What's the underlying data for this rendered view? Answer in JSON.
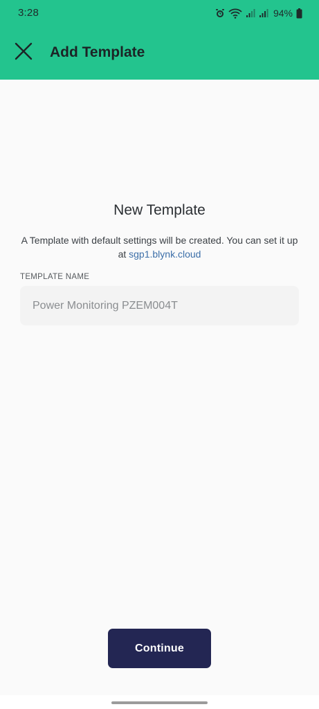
{
  "status_bar": {
    "time": "3:28",
    "battery_percent": "94%",
    "icons": [
      "alarm-icon",
      "wifi-icon",
      "signal-icon",
      "signal-icon",
      "battery-icon"
    ]
  },
  "app_bar": {
    "title": "Add Template",
    "close_icon": "close-icon",
    "background_color": "#23c48e"
  },
  "main": {
    "heading": "New Template",
    "description_prefix": "A Template with default settings will be created. You can set it up at ",
    "description_link": "sgp1.blynk.cloud",
    "field_label": "TEMPLATE NAME",
    "field_value": "Power Monitoring PZEM004T",
    "link_color": "#3b6ea8"
  },
  "actions": {
    "continue_label": "Continue",
    "button_color": "#232653"
  }
}
